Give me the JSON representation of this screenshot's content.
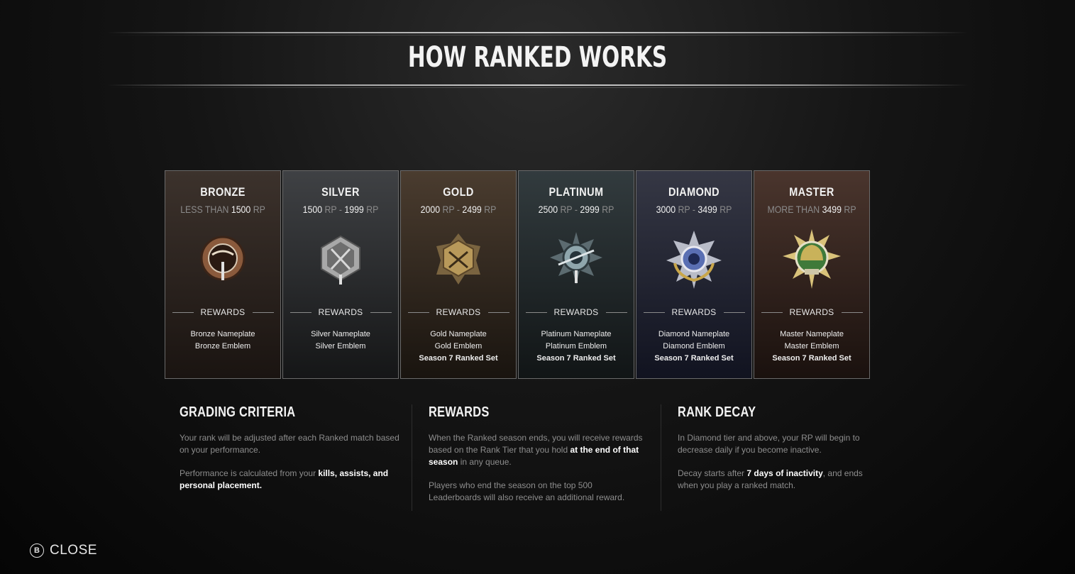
{
  "title": "HOW RANKED WORKS",
  "rewards_label": "REWARDS",
  "tiers": [
    {
      "name": "BRONZE",
      "range_a": "LESS THAN",
      "range_b": "1500",
      "range_c": "RP",
      "range_d": "",
      "range_e": "",
      "rewards": [
        "Bronze Nameplate",
        "Bronze Emblem"
      ],
      "bold_reward": "",
      "colors": {
        "top": "#3c322c",
        "bottom": "#1a1411",
        "emblem": "#8a5a3c"
      },
      "icon": "bronze-emblem-icon"
    },
    {
      "name": "SILVER",
      "range_a": "",
      "range_b": "1500",
      "range_c": "RP",
      "range_d": "-",
      "range_e": "1999",
      "rewards": [
        "Silver Nameplate",
        "Silver Emblem"
      ],
      "bold_reward": "",
      "colors": {
        "top": "#3f4144",
        "bottom": "#151617",
        "emblem": "#a8a8a8"
      },
      "icon": "silver-emblem-icon"
    },
    {
      "name": "GOLD",
      "range_a": "",
      "range_b": "2000",
      "range_c": "RP",
      "range_d": "-",
      "range_e": "2499",
      "rewards": [
        "Gold Nameplate",
        "Gold Emblem"
      ],
      "bold_reward": "Season 7 Ranked Set",
      "colors": {
        "top": "#4a3c2f",
        "bottom": "#19140f",
        "emblem": "#b8995a"
      },
      "icon": "gold-emblem-icon"
    },
    {
      "name": "PLATINUM",
      "range_a": "",
      "range_b": "2500",
      "range_c": "RP",
      "range_d": "-",
      "range_e": "2999",
      "rewards": [
        "Platinum Nameplate",
        "Platinum Emblem"
      ],
      "bold_reward": "Season 7 Ranked Set",
      "colors": {
        "top": "#323b3e",
        "bottom": "#111516",
        "emblem": "#8fa6ac"
      },
      "icon": "platinum-emblem-icon"
    },
    {
      "name": "DIAMOND",
      "range_a": "",
      "range_b": "3000",
      "range_c": "RP",
      "range_d": "-",
      "range_e": "3499",
      "rewards": [
        "Diamond Nameplate",
        "Diamond Emblem"
      ],
      "bold_reward": "Season 7 Ranked Set",
      "colors": {
        "top": "#353744",
        "bottom": "#111320",
        "emblem": "#5a6fb3"
      },
      "icon": "diamond-emblem-icon"
    },
    {
      "name": "MASTER",
      "range_a": "MORE THAN",
      "range_b": "3499",
      "range_c": "RP",
      "range_d": "",
      "range_e": "",
      "rewards": [
        "Master Nameplate",
        "Master Emblem"
      ],
      "bold_reward": "Season 7 Ranked Set",
      "colors": {
        "top": "#4a352d",
        "bottom": "#1a110e",
        "emblem": "#c9b25a"
      },
      "icon": "master-emblem-icon"
    }
  ],
  "sections": {
    "grading": {
      "title": "GRADING CRITERIA",
      "p1": "Your rank will be adjusted after each Ranked match based on your performance.",
      "p2_a": "Performance is calculated from your ",
      "p2_b": "kills, assists, and personal placement."
    },
    "rewards": {
      "title": "REWARDS",
      "p1_a": "When the Ranked season ends, you will receive rewards based on the Rank Tier that you hold ",
      "p1_b": "at the end of that season",
      "p1_c": " in any queue.",
      "p2": "Players who end the season on the top 500 Leaderboards will also receive an additional reward."
    },
    "decay": {
      "title": "RANK DECAY",
      "p1": "In Diamond tier and above, your RP will begin to decrease daily if you become inactive.",
      "p2_a": "Decay starts after ",
      "p2_b": "7 days of inactivity",
      "p2_c": ", and ends when you play a ranked match."
    }
  },
  "close": {
    "button": "B",
    "label": "CLOSE"
  }
}
